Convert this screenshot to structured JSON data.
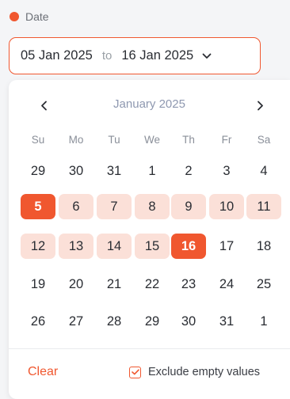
{
  "filter": {
    "label": "Date",
    "dot_color": "#f0572f"
  },
  "range": {
    "start": "05 Jan 2025",
    "separator": "to",
    "end": "16 Jan 2025",
    "chevron_icon": "chevron-down-icon"
  },
  "calendar": {
    "month_title": "January 2025",
    "prev_icon": "chevron-left-icon",
    "next_icon": "chevron-right-icon",
    "weekdays": [
      "Su",
      "Mo",
      "Tu",
      "We",
      "Th",
      "Fr",
      "Sa"
    ],
    "weeks": [
      [
        "29",
        "30",
        "31",
        "1",
        "2",
        "3",
        "4"
      ],
      [
        "5",
        "6",
        "7",
        "8",
        "9",
        "10",
        "11"
      ],
      [
        "12",
        "13",
        "14",
        "15",
        "16",
        "17",
        "18"
      ],
      [
        "19",
        "20",
        "21",
        "22",
        "23",
        "24",
        "25"
      ],
      [
        "26",
        "27",
        "28",
        "29",
        "30",
        "31",
        "1"
      ]
    ],
    "selected_start": "5",
    "selected_end": "16",
    "accent_color": "#f0572f",
    "range_color": "#fbe0d8"
  },
  "footer": {
    "clear_label": "Clear",
    "exclude_label": "Exclude empty values",
    "exclude_checked": true
  }
}
